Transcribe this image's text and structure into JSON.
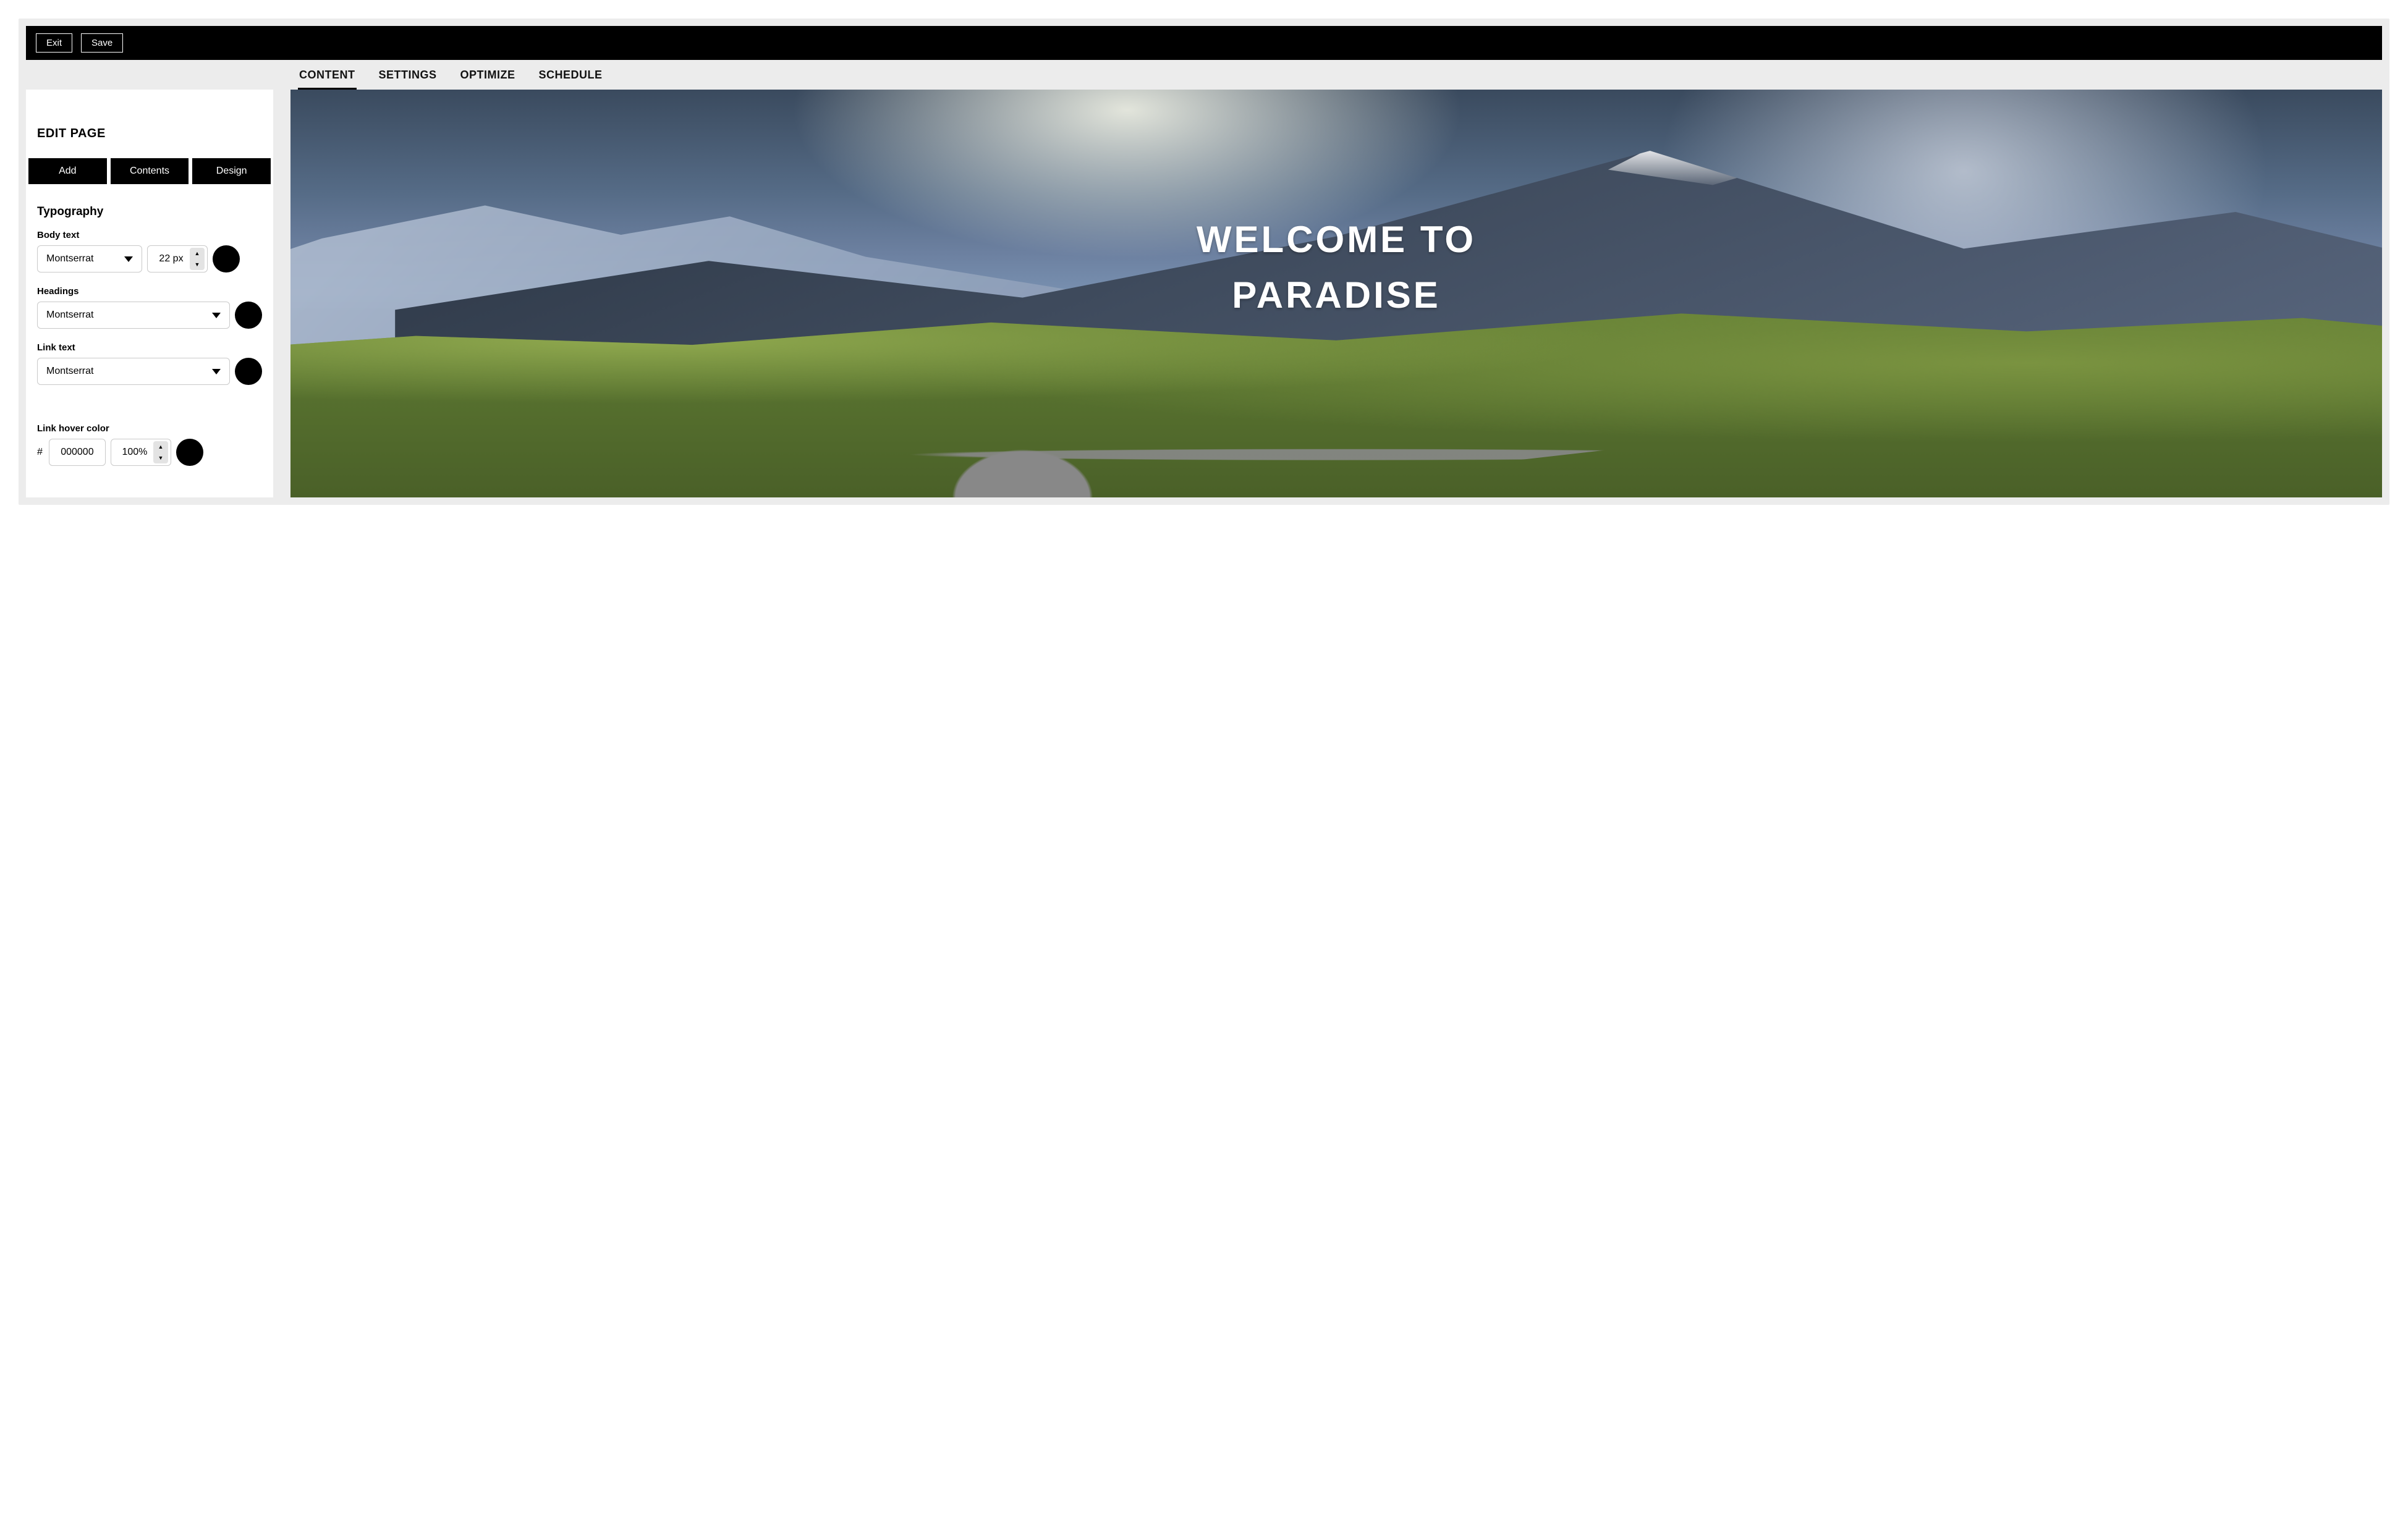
{
  "toolbar": {
    "exit": "Exit",
    "save": "Save"
  },
  "tabs": {
    "content": "CONTENT",
    "settings": "SETTINGS",
    "optimize": "OPTIMIZE",
    "schedule": "SCHEDULE",
    "active": "content"
  },
  "sidebar": {
    "title": "EDIT PAGE",
    "tabs": {
      "add": "Add",
      "contents": "Contents",
      "design": "Design"
    },
    "typography": {
      "heading": "Typography",
      "body_text": {
        "label": "Body text",
        "font": "Montserrat",
        "size": "22 px",
        "color": "#000000"
      },
      "headings": {
        "label": "Headings",
        "font": "Montserrat",
        "color": "#000000"
      },
      "link_text": {
        "label": "Link text",
        "font": "Montserrat",
        "color": "#000000"
      },
      "link_hover": {
        "label": "Link hover color",
        "hash": "#",
        "hex": "000000",
        "opacity": "100%",
        "color": "#000000"
      }
    }
  },
  "canvas": {
    "hero_text": "WELCOME TO\nPARADISE"
  }
}
